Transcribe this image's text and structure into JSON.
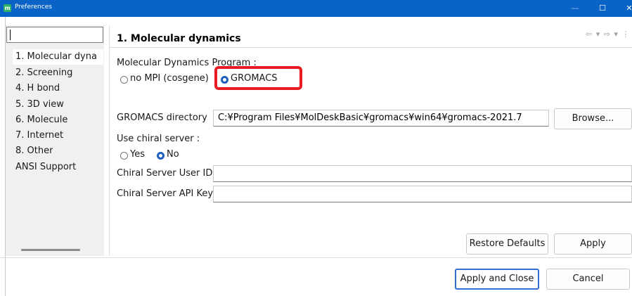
{
  "window": {
    "title": "Preferences",
    "app_icon_letter": "m",
    "minimize_glyph": "—",
    "maximize_glyph": "☐",
    "close_glyph": "✕"
  },
  "sidebar": {
    "filter_value": "",
    "items": [
      {
        "label": "1. Molecular dyna",
        "selected": true
      },
      {
        "label": "2. Screening"
      },
      {
        "label": "4. H bond"
      },
      {
        "label": "5. 3D view"
      },
      {
        "label": "6. Molecule"
      },
      {
        "label": "7. Internet"
      },
      {
        "label": "8. Other"
      },
      {
        "label": "ANSI Support"
      }
    ]
  },
  "page": {
    "title": "1. Molecular dynamics",
    "nav_arrows": "⇦ ▾ ⇨ ▾ ⋮",
    "md_program_label": "Molecular Dynamics Program :",
    "md_options": [
      "no MPI (cosgene)",
      "GROMACS"
    ],
    "md_selected": "GROMACS",
    "gromacs_dir_label": "GROMACS directory",
    "gromacs_dir_value": "C:¥Program Files¥MolDeskBasic¥gromacs¥win64¥gromacs-2021.7",
    "browse_label": "Browse...",
    "chiral_label": "Use chiral server :",
    "chiral_options": [
      "Yes",
      "No"
    ],
    "chiral_selected": "No",
    "chiral_user_label": "Chiral Server User ID",
    "chiral_user_value": "",
    "chiral_api_label": "Chiral Server API Key",
    "chiral_api_value": "",
    "restore_label": "Restore Defaults",
    "apply_label": "Apply"
  },
  "footer": {
    "apply_close_label": "Apply and Close",
    "cancel_label": "Cancel"
  },
  "colors": {
    "titlebar": "#0a63c7",
    "highlight": "#e81a22",
    "radio_selected": "#1f5fbf"
  }
}
